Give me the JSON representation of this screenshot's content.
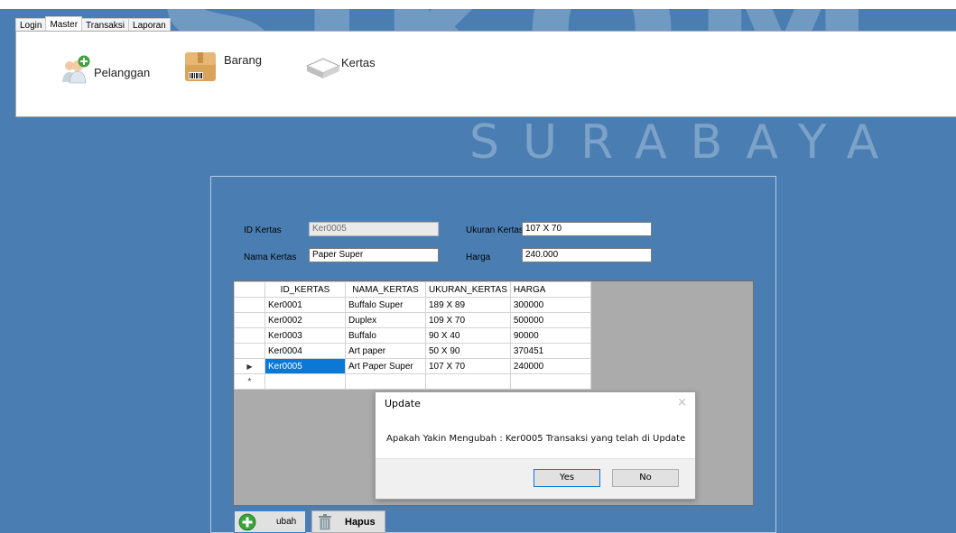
{
  "watermark": {
    "big": "SIKOM",
    "small": "SURABAYA"
  },
  "menu": {
    "tabs": [
      "Login",
      "Master",
      "Transaksi",
      "Laporan"
    ],
    "active": "Master"
  },
  "ribbon": {
    "items": [
      {
        "label": "Pelanggan",
        "icon": "add-user-icon"
      },
      {
        "label": "Barang",
        "icon": "box-barcode-icon"
      },
      {
        "label": "Kertas",
        "icon": "paper-stack-icon"
      }
    ]
  },
  "form": {
    "id_label": "ID Kertas",
    "id_value": "Ker0005",
    "nama_label": "Nama Kertas",
    "nama_value": "Paper Super",
    "ukuran_label": "Ukuran Kertas",
    "ukuran_value": "107 X 70",
    "harga_label": "Harga",
    "harga_value": "240.000"
  },
  "grid": {
    "columns": [
      "ID_KERTAS",
      "NAMA_KERTAS",
      "UKURAN_KERTAS",
      "HARGA"
    ],
    "rows": [
      [
        "Ker0001",
        "Buffalo Super",
        "189 X 89",
        "300000"
      ],
      [
        "Ker0002",
        "Duplex",
        "109 X 70",
        "500000"
      ],
      [
        "Ker0003",
        "Buffalo",
        "90 X 40",
        "90000"
      ],
      [
        "Ker0004",
        "Art paper",
        "50 X 90",
        "370451"
      ],
      [
        "Ker0005",
        "Art Paper Super",
        "107 X 70",
        "240000"
      ]
    ],
    "current_marker": "▶",
    "new_row_marker": "*"
  },
  "dialog": {
    "title": "Update",
    "close": "×",
    "message": "Apakah Yakin Mengubah : Ker0005 Transaksi yang telah di Update",
    "yes": "Yes",
    "no": "No"
  },
  "buttons": {
    "ubah": "ubah",
    "hapus": "Hapus"
  },
  "colors": {
    "background": "#4a7eb3",
    "selection": "#0a78d7"
  }
}
